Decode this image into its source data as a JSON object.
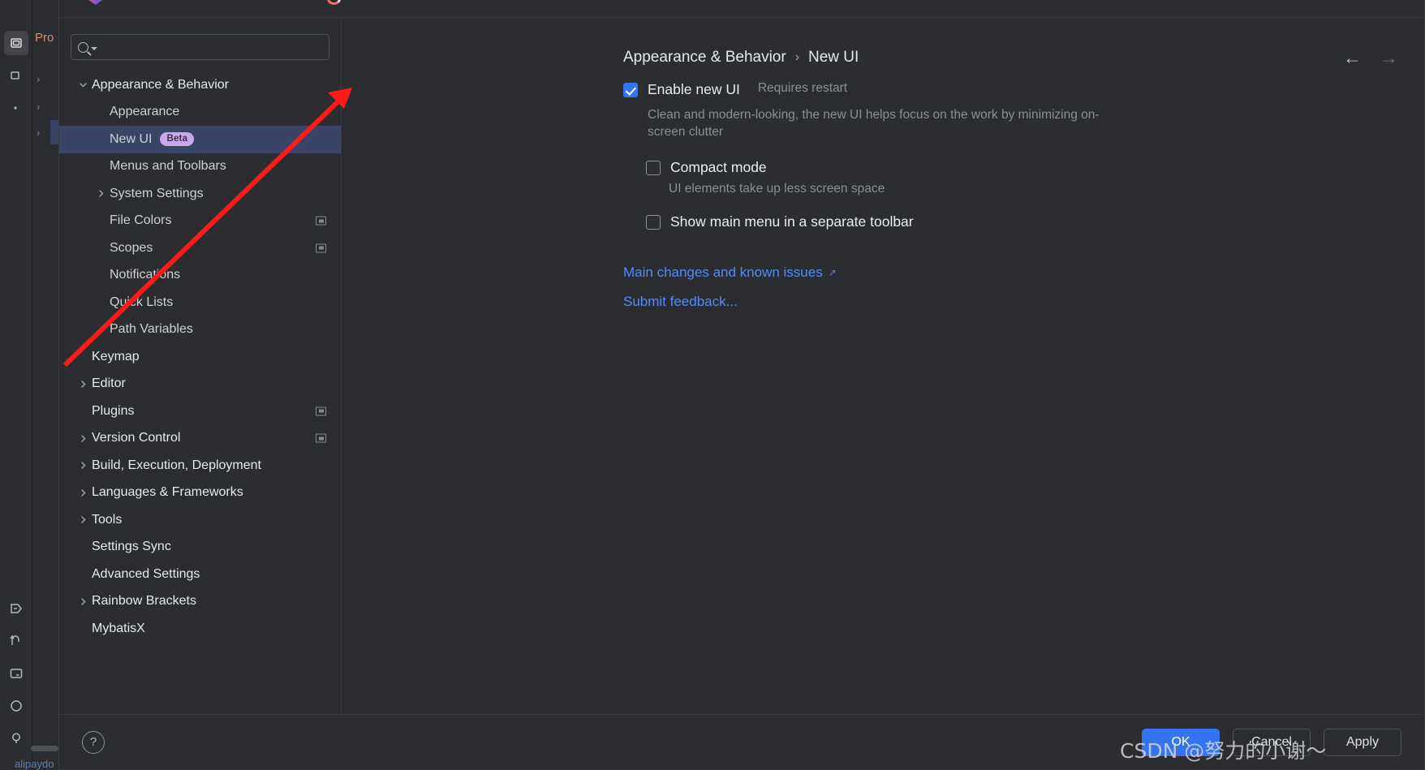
{
  "background_ide": {
    "project_panel_title": "Pro",
    "bottom_label": "alipaydo",
    "rail_icons": [
      "project-icon",
      "structure-icon",
      "bookmarks-icon",
      "commit-icon",
      "pull-requests-icon",
      "terminal-icon",
      "services-icon",
      "problems-icon"
    ],
    "tree_chevrons": [
      "chevron-right",
      "chevron-right",
      "chevron-right"
    ]
  },
  "search": {
    "value": "",
    "placeholder": "",
    "icon": "search-icon"
  },
  "tree": [
    {
      "label": "Appearance & Behavior",
      "level": 0,
      "expanded": true,
      "arrow": "chevron-down",
      "selected": false,
      "badge": "",
      "trailing_icon": ""
    },
    {
      "label": "Appearance",
      "level": 1,
      "expanded": false,
      "arrow": "",
      "selected": false,
      "badge": "",
      "trailing_icon": ""
    },
    {
      "label": "New UI",
      "level": 1,
      "expanded": false,
      "arrow": "",
      "selected": true,
      "badge": "Beta",
      "trailing_icon": ""
    },
    {
      "label": "Menus and Toolbars",
      "level": 1,
      "expanded": false,
      "arrow": "",
      "selected": false,
      "badge": "",
      "trailing_icon": ""
    },
    {
      "label": "System Settings",
      "level": 1,
      "expanded": false,
      "arrow": "chevron-right",
      "selected": false,
      "badge": "",
      "trailing_icon": ""
    },
    {
      "label": "File Colors",
      "level": 1,
      "expanded": false,
      "arrow": "",
      "selected": false,
      "badge": "",
      "trailing_icon": "monitor-icon"
    },
    {
      "label": "Scopes",
      "level": 1,
      "expanded": false,
      "arrow": "",
      "selected": false,
      "badge": "",
      "trailing_icon": "monitor-icon"
    },
    {
      "label": "Notifications",
      "level": 1,
      "expanded": false,
      "arrow": "",
      "selected": false,
      "badge": "",
      "trailing_icon": ""
    },
    {
      "label": "Quick Lists",
      "level": 1,
      "expanded": false,
      "arrow": "",
      "selected": false,
      "badge": "",
      "trailing_icon": ""
    },
    {
      "label": "Path Variables",
      "level": 1,
      "expanded": false,
      "arrow": "",
      "selected": false,
      "badge": "",
      "trailing_icon": ""
    },
    {
      "label": "Keymap",
      "level": 0,
      "expanded": false,
      "arrow": "",
      "selected": false,
      "badge": "",
      "trailing_icon": ""
    },
    {
      "label": "Editor",
      "level": 0,
      "expanded": false,
      "arrow": "chevron-right",
      "selected": false,
      "badge": "",
      "trailing_icon": ""
    },
    {
      "label": "Plugins",
      "level": 0,
      "expanded": false,
      "arrow": "",
      "selected": false,
      "badge": "",
      "trailing_icon": "monitor-icon"
    },
    {
      "label": "Version Control",
      "level": 0,
      "expanded": false,
      "arrow": "chevron-right",
      "selected": false,
      "badge": "",
      "trailing_icon": "monitor-icon"
    },
    {
      "label": "Build, Execution, Deployment",
      "level": 0,
      "expanded": false,
      "arrow": "chevron-right",
      "selected": false,
      "badge": "",
      "trailing_icon": ""
    },
    {
      "label": "Languages & Frameworks",
      "level": 0,
      "expanded": false,
      "arrow": "chevron-right",
      "selected": false,
      "badge": "",
      "trailing_icon": ""
    },
    {
      "label": "Tools",
      "level": 0,
      "expanded": false,
      "arrow": "chevron-right",
      "selected": false,
      "badge": "",
      "trailing_icon": ""
    },
    {
      "label": "Settings Sync",
      "level": 0,
      "expanded": false,
      "arrow": "",
      "selected": false,
      "badge": "",
      "trailing_icon": ""
    },
    {
      "label": "Advanced Settings",
      "level": 0,
      "expanded": false,
      "arrow": "",
      "selected": false,
      "badge": "",
      "trailing_icon": ""
    },
    {
      "label": "Rainbow Brackets",
      "level": 0,
      "expanded": false,
      "arrow": "chevron-right",
      "selected": false,
      "badge": "",
      "trailing_icon": ""
    },
    {
      "label": "MybatisX",
      "level": 0,
      "expanded": false,
      "arrow": "",
      "selected": false,
      "badge": "",
      "trailing_icon": ""
    }
  ],
  "breadcrumb": {
    "parent": "Appearance & Behavior",
    "separator": "›",
    "current": "New UI"
  },
  "nav": {
    "back": "←",
    "forward": "→"
  },
  "main": {
    "enable_new_ui": {
      "label": "Enable new UI",
      "hint": "Requires restart",
      "checked": true,
      "description": "Clean and modern-looking, the new UI helps focus on the work by minimizing on-screen clutter"
    },
    "compact_mode": {
      "label": "Compact mode",
      "checked": false,
      "description": "UI elements take up less screen space"
    },
    "separate_toolbar": {
      "label": "Show main menu in a separate toolbar",
      "checked": false
    },
    "links": [
      {
        "label": "Main changes and known issues",
        "external": true
      },
      {
        "label": "Submit feedback...",
        "external": false
      }
    ],
    "external_glyph": "↗"
  },
  "footer": {
    "help": "?",
    "ok": "OK",
    "cancel": "Cancel",
    "apply": "Apply"
  },
  "watermark": "CSDN @努力的小谢～",
  "colors": {
    "accent": "#3574f0",
    "selection": "#3a4466",
    "badge": "#c8aaea",
    "link": "#548af7",
    "panel": "#2b2d30",
    "annotation": "#ff1a1a"
  }
}
